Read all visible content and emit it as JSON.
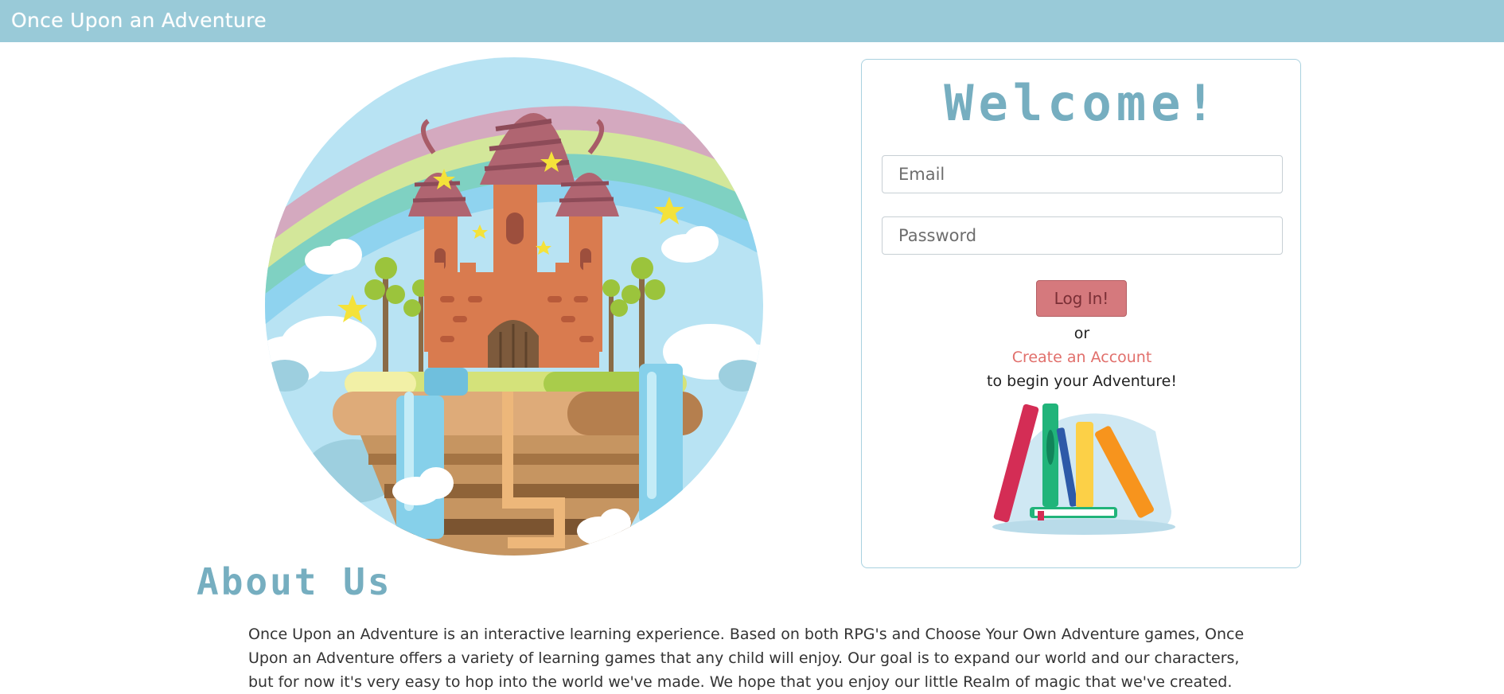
{
  "header": {
    "title": "Once Upon an Adventure"
  },
  "login": {
    "heading": "Welcome!",
    "email_placeholder": "Email",
    "password_placeholder": "Password",
    "login_label": "Log In!",
    "or_text": "or",
    "create_account_label": "Create an Account",
    "begin_text": "to begin your Adventure!"
  },
  "about": {
    "heading": "About Us",
    "body": "Once Upon an Adventure is an interactive learning experience. Based on both RPG's and Choose Your Own Adventure games, Once Upon an Adventure offers a variety of learning games that any child will enjoy. Our goal is to expand our world and our characters, but for now it's very easy to hop into the world we've made. We hope that you enjoy our little Realm of magic that we've created."
  },
  "colors": {
    "header_bg": "#99cad8",
    "accent_blue": "#76aec0",
    "button_bg": "#d5797d",
    "link": "#e16f6b"
  }
}
